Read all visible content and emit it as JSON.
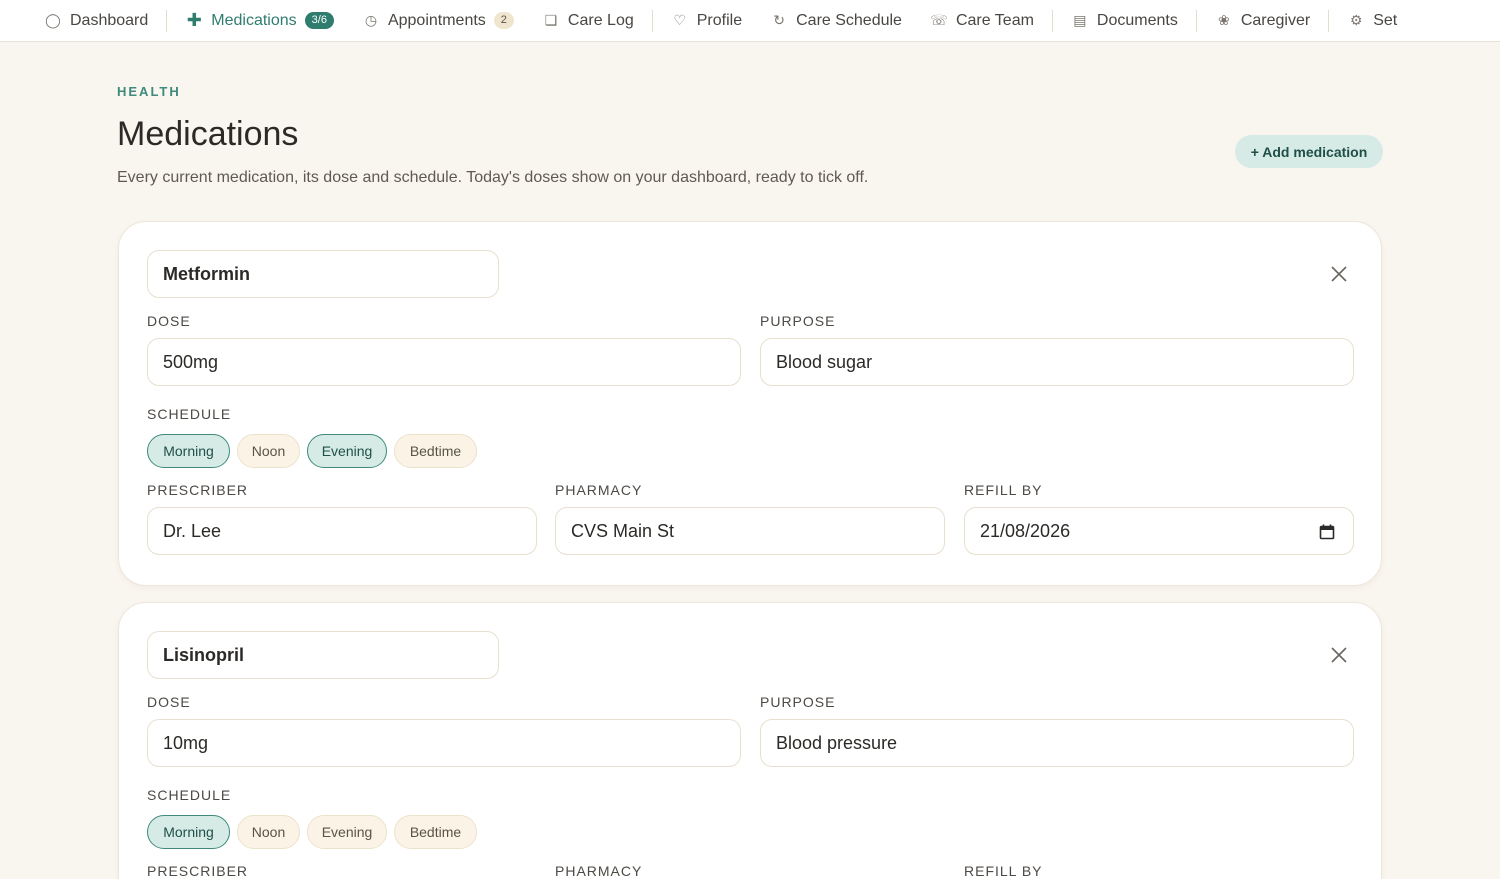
{
  "nav": {
    "items": [
      {
        "label": "Dashboard",
        "icon": "circle-icon"
      },
      {
        "label": "Medications",
        "icon": "plus-icon",
        "badge": "3/6",
        "active": true
      },
      {
        "label": "Appointments",
        "icon": "clock-icon",
        "badge": "2"
      },
      {
        "label": "Care Log",
        "icon": "notebook-icon"
      },
      {
        "label": "Profile",
        "icon": "heart-icon"
      },
      {
        "label": "Care Schedule",
        "icon": "refresh-icon"
      },
      {
        "label": "Care Team",
        "icon": "phone-icon"
      },
      {
        "label": "Documents",
        "icon": "document-icon"
      },
      {
        "label": "Caregiver",
        "icon": "flower-icon"
      },
      {
        "label": "Set",
        "icon": "gear-icon"
      }
    ]
  },
  "header": {
    "eyebrow": "HEALTH",
    "title": "Medications",
    "subtitle": "Every current medication, its dose and schedule. Today's doses show on your dashboard, ready to tick off.",
    "add_button": "+ Add medication"
  },
  "labels": {
    "dose": "DOSE",
    "purpose": "PURPOSE",
    "schedule": "SCHEDULE",
    "prescriber": "PRESCRIBER",
    "pharmacy": "PHARMACY",
    "refill_by": "REFILL BY"
  },
  "schedule_options": [
    "Morning",
    "Noon",
    "Evening",
    "Bedtime"
  ],
  "medications": [
    {
      "name": "Metformin",
      "dose": "500mg",
      "purpose": "Blood sugar",
      "schedule": {
        "Morning": true,
        "Noon": false,
        "Evening": true,
        "Bedtime": false
      },
      "prescriber": "Dr. Lee",
      "pharmacy": "CVS Main St",
      "refill_by": "21/08/2026"
    },
    {
      "name": "Lisinopril",
      "dose": "10mg",
      "purpose": "Blood pressure",
      "schedule": {
        "Morning": true,
        "Noon": false,
        "Evening": false,
        "Bedtime": false
      }
    }
  ],
  "colors": {
    "accent": "#2e7d6f",
    "background": "#f9f5ef",
    "chip_selected_bg": "#d6ebe6",
    "chip_unselected_bg": "#fbf4e6"
  }
}
